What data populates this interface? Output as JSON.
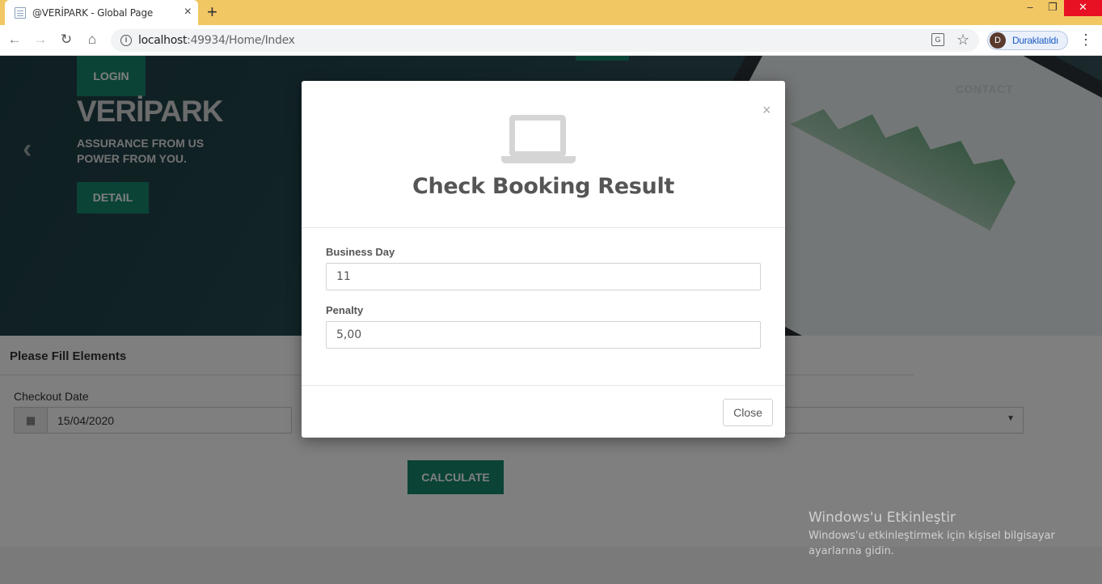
{
  "browser": {
    "tab_title": "@VERİPARK - Global Page",
    "tab_close": "×",
    "new_tab": "+",
    "url_host": "localhost",
    "url_path": ":49934/Home/Index",
    "profile_initial": "D",
    "profile_label": "Duraklatıldı",
    "window_min": "–",
    "window_max": "❐",
    "window_close": "✕"
  },
  "hero": {
    "login_label": "LOGIN",
    "brand": "VERİPARK",
    "tagline_line1": "ASSURANCE FROM US",
    "tagline_line2": "POWER FROM YOU.",
    "detail_label": "DETAIL",
    "nav_contact": "CONTACT",
    "prev_arrow": "‹"
  },
  "form": {
    "heading": "Please Fill Elements",
    "checkout_label": "Checkout Date",
    "checkout_value": "15/04/2020",
    "select_caret": "▼",
    "calculate_label": "CALCULATE"
  },
  "modal": {
    "close_x": "×",
    "title": "Check Booking Result",
    "business_day_label": "Business Day",
    "business_day_value": "11",
    "penalty_label": "Penalty",
    "penalty_value": "5,00",
    "close_label": "Close"
  },
  "watermark": {
    "title": "Windows'u Etkinleştir",
    "subtitle": "Windows'u etkinleştirmek için kişisel bilgisayar ayarlarına gidin."
  },
  "colors": {
    "accent": "#17876d",
    "tabbar": "#f1c764",
    "hero_bg": "#24484f"
  }
}
